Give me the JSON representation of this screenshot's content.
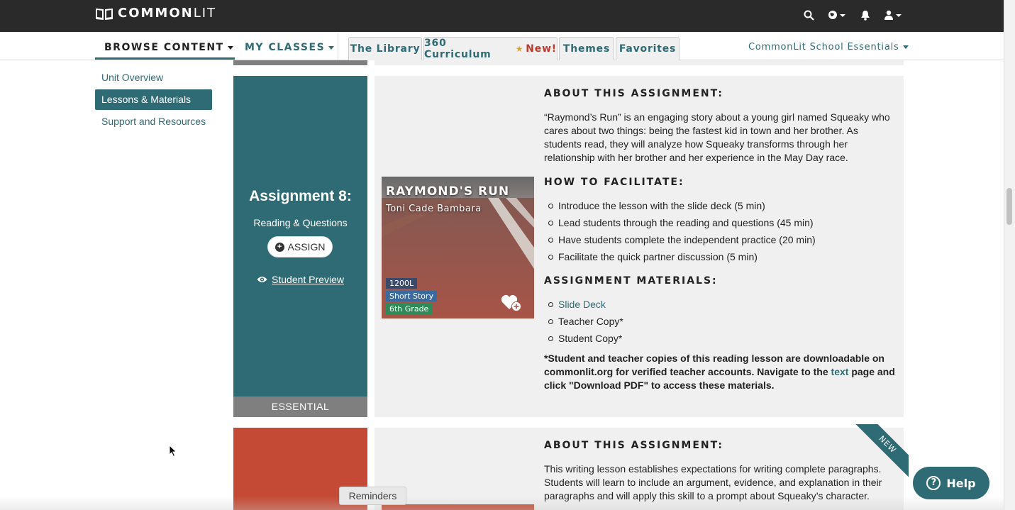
{
  "brand": {
    "name_bold": "COMMON",
    "name_light": "LIT"
  },
  "topbar_icons": [
    "search-icon",
    "globe-icon",
    "bell-icon",
    "user-icon"
  ],
  "nav": {
    "browse": "BROWSE CONTENT",
    "classes": "MY CLASSES",
    "tabs": [
      {
        "label": "The Library"
      },
      {
        "label": "360 Curriculum",
        "badge": "New!"
      },
      {
        "label": "Themes"
      },
      {
        "label": "Favorites"
      }
    ],
    "essentials": "CommonLit School Essentials"
  },
  "sidebar": {
    "items": [
      {
        "label": "Unit Overview",
        "active": false
      },
      {
        "label": "Lessons & Materials",
        "active": true
      },
      {
        "label": "Support and Resources",
        "active": false
      }
    ]
  },
  "assignment": {
    "title": "Assignment 8:",
    "subtitle": "Reading & Questions",
    "assign_label": "ASSIGN",
    "preview_label": "Student Preview",
    "tier": "ESSENTIAL",
    "text": {
      "title": "RAYMOND'S RUN",
      "author": "Toni Cade Bambara",
      "lexile": "1200L",
      "genre": "Short Story",
      "grade": "6th Grade"
    },
    "about_heading": "ABOUT THIS ASSIGNMENT:",
    "about_body": "“Raymond’s Run” is an engaging story about a young girl named Squeaky who cares about two things: being the fastest kid in town and her brother. As students read, they will analyze how Squeaky transforms through her relationship with her brother and her experience in the May Day race.",
    "facilitate_heading": "HOW TO FACILITATE:",
    "facilitate_steps": [
      "Introduce the lesson with the slide deck (5 min)",
      "Lead students through the reading and questions (45 min)",
      "Have students complete the independent practice (20 min)",
      "Facilitate the quick partner discussion (5 min)"
    ],
    "materials_heading": "ASSIGNMENT MATERIALS:",
    "materials": [
      "Slide Deck",
      "Teacher Copy*",
      "Student Copy*"
    ],
    "note_before": "*Student and teacher copies of this reading lesson are downloadable on commonlit.org for verified teacher accounts. Navigate to the ",
    "note_link": "text",
    "note_after": " page and click \"Download PDF\" to access these materials."
  },
  "next_assignment": {
    "ribbon": "NEW",
    "about_heading": "ABOUT THIS ASSIGNMENT:",
    "about_body": "This writing lesson establishes expectations for writing complete paragraphs. Students will learn to include an argument, evidence, and explanation in their paragraphs and will apply this skill to a prompt about Squeaky’s character."
  },
  "reminders_label": "Reminders",
  "help_label": "Help",
  "colors": {
    "teal": "#2e6b74",
    "topbar": "#2a2a2a",
    "panel": "#f0f0f0",
    "red_card": "#c44a35"
  }
}
